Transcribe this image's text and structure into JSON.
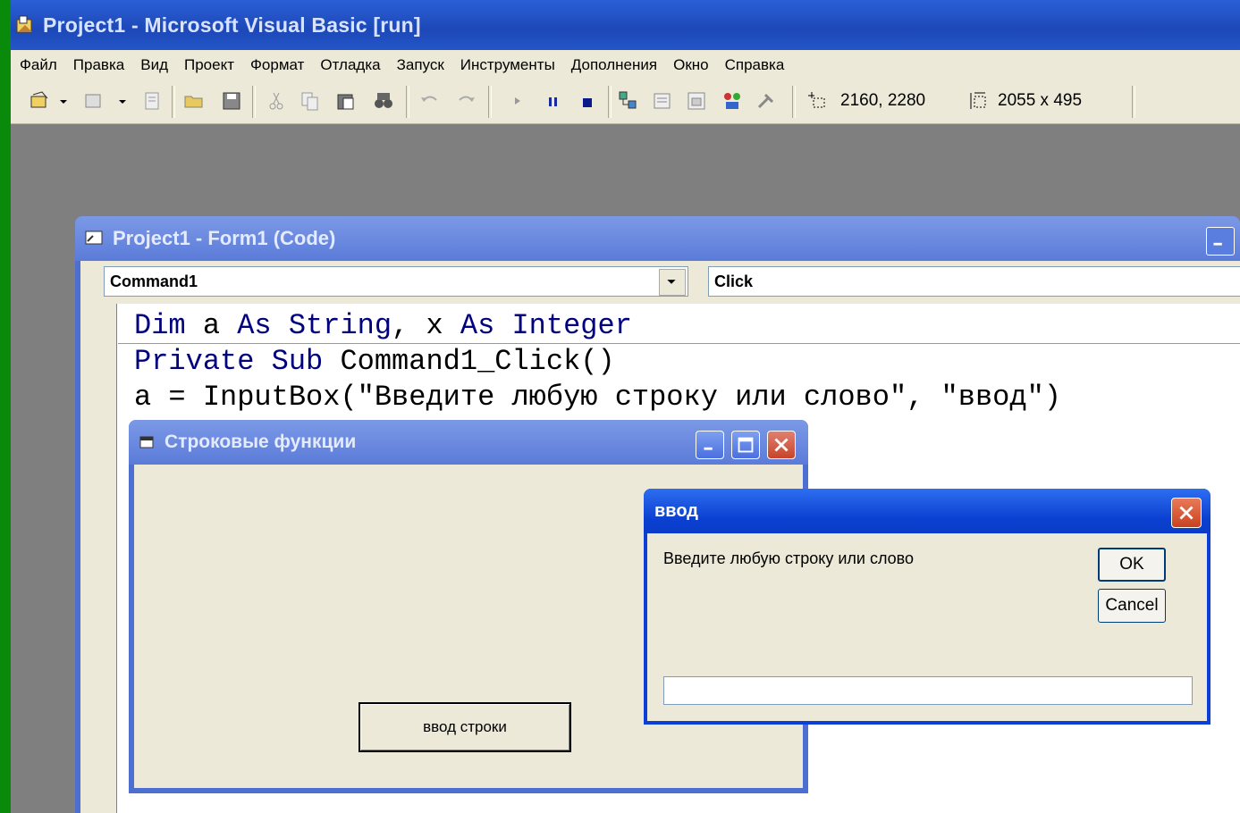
{
  "app": {
    "title": "Project1 - Microsoft Visual Basic [run]"
  },
  "menu": [
    "Файл",
    "Правка",
    "Вид",
    "Проект",
    "Формат",
    "Отладка",
    "Запуск",
    "Инструменты",
    "Дополнения",
    "Окно",
    "Справка"
  ],
  "toolbar": {
    "position_readout": "2160, 2280",
    "size_readout": "2055 x 495"
  },
  "code_window": {
    "title": "Project1 - Form1 (Code)",
    "object_combo": "Command1",
    "procedure_combo": "Click",
    "lines": [
      {
        "kw1": "Dim",
        "t1": " a ",
        "kw2": "As",
        "t2": " ",
        "kw3": "String",
        "t3": ", x ",
        "kw4": "As",
        "t4": " ",
        "kw5": "Integer"
      },
      {
        "kw1": "Private",
        "t1": " ",
        "kw2": "Sub",
        "t2": " Command1_Click()"
      },
      {
        "text": "a = InputBox(\"Введите любую строку или слово\", \"ввод\")"
      }
    ]
  },
  "form_window": {
    "title": "Строковые функции",
    "button_label": "ввод строки"
  },
  "input_dialog": {
    "title": "ввод",
    "prompt": "Введите любую строку или слово",
    "ok_label": "OK",
    "cancel_label": "Cancel",
    "input_value": ""
  }
}
